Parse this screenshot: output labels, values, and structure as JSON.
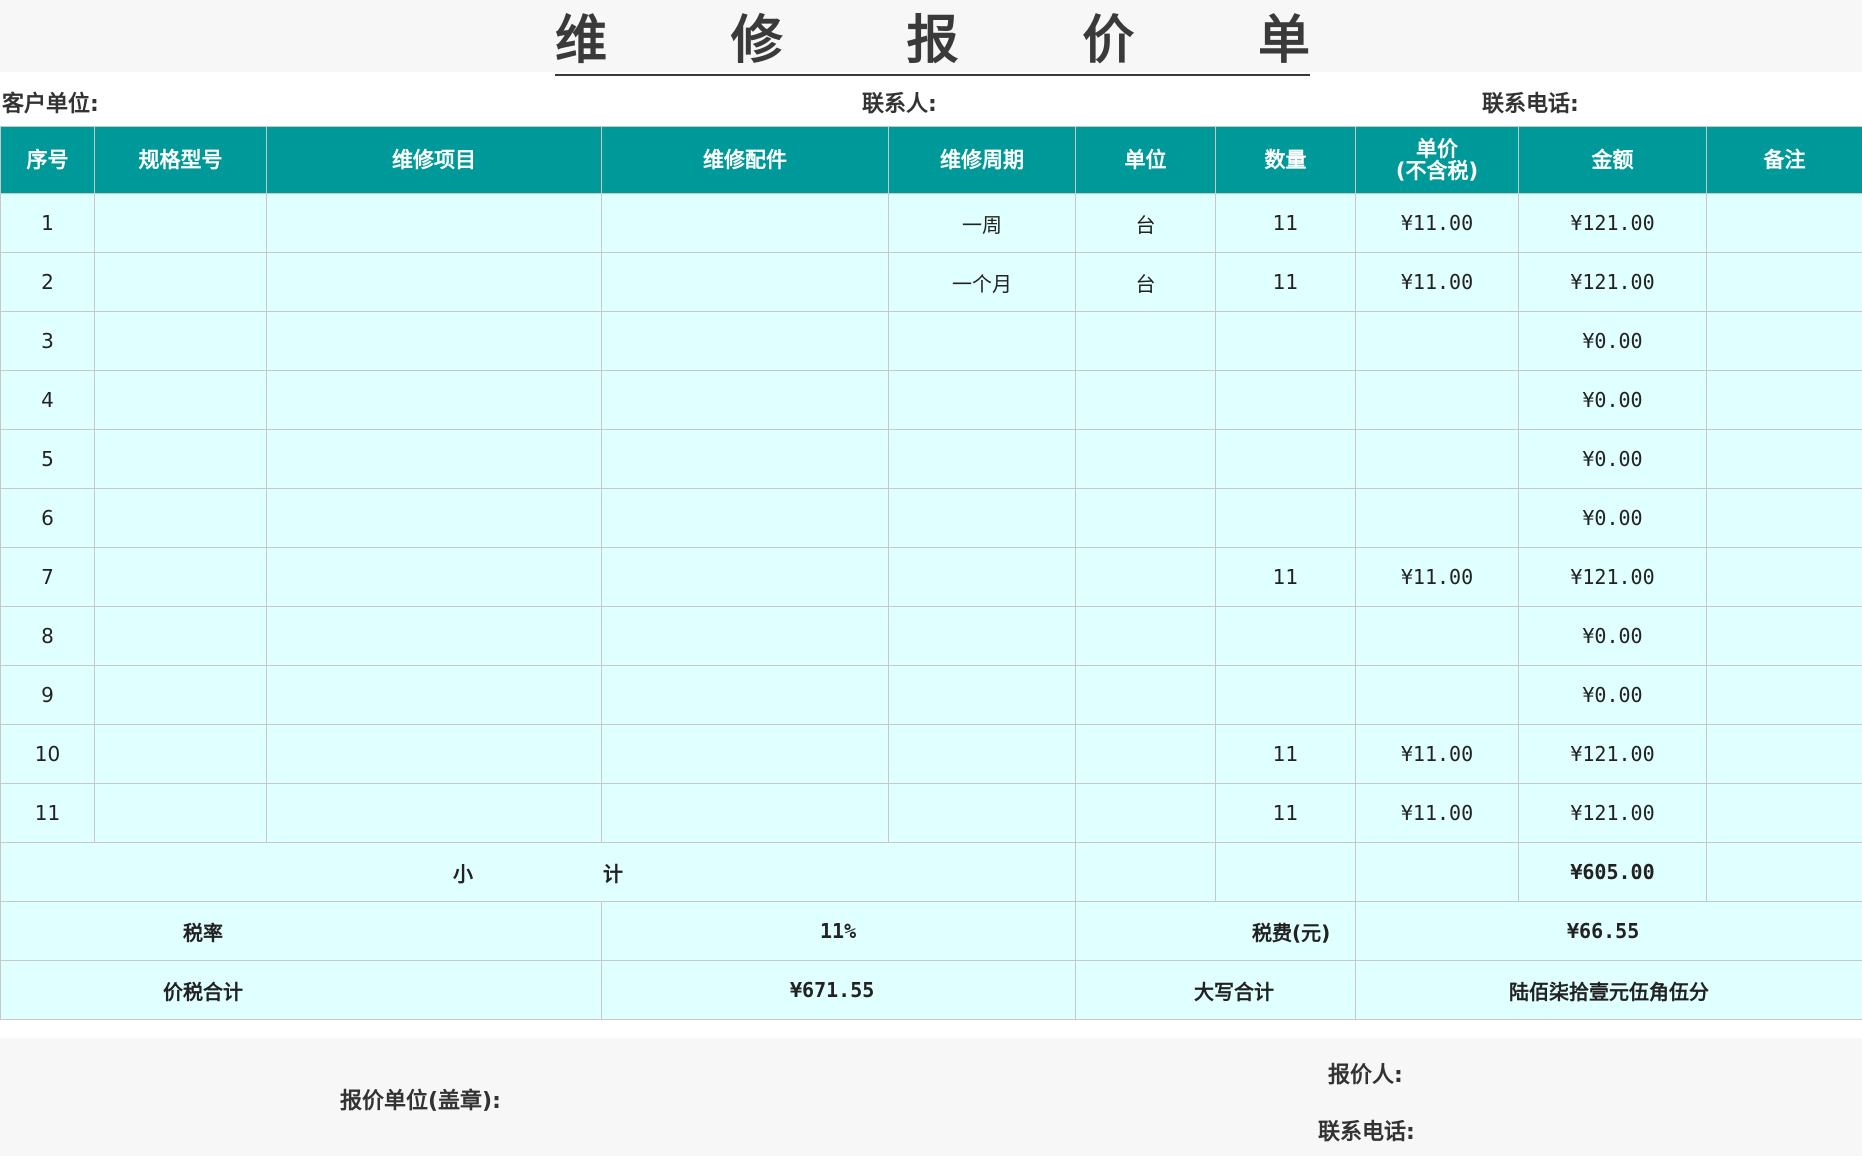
{
  "title": [
    "维",
    "修",
    "报",
    "价",
    "单"
  ],
  "info": {
    "client_label": "客户单位:",
    "contact_label": "联系人:",
    "phone_label": "联系电话:"
  },
  "headers": [
    "序号",
    "规格型号",
    "维修项目",
    "维修配件",
    "维修周期",
    "单位",
    "数量",
    "单价\n(不含税)",
    "金额",
    "备注"
  ],
  "rows": [
    {
      "no": "1",
      "spec": "",
      "item": "",
      "part": "",
      "cycle": "一周",
      "unit": "台",
      "qty": "11",
      "price": "¥11.00",
      "amount": "¥121.00",
      "note": ""
    },
    {
      "no": "2",
      "spec": "",
      "item": "",
      "part": "",
      "cycle": "一个月",
      "unit": "台",
      "qty": "11",
      "price": "¥11.00",
      "amount": "¥121.00",
      "note": ""
    },
    {
      "no": "3",
      "spec": "",
      "item": "",
      "part": "",
      "cycle": "",
      "unit": "",
      "qty": "",
      "price": "",
      "amount": "¥0.00",
      "note": ""
    },
    {
      "no": "4",
      "spec": "",
      "item": "",
      "part": "",
      "cycle": "",
      "unit": "",
      "qty": "",
      "price": "",
      "amount": "¥0.00",
      "note": ""
    },
    {
      "no": "5",
      "spec": "",
      "item": "",
      "part": "",
      "cycle": "",
      "unit": "",
      "qty": "",
      "price": "",
      "amount": "¥0.00",
      "note": ""
    },
    {
      "no": "6",
      "spec": "",
      "item": "",
      "part": "",
      "cycle": "",
      "unit": "",
      "qty": "",
      "price": "",
      "amount": "¥0.00",
      "note": ""
    },
    {
      "no": "7",
      "spec": "",
      "item": "",
      "part": "",
      "cycle": "",
      "unit": "",
      "qty": "11",
      "price": "¥11.00",
      "amount": "¥121.00",
      "note": ""
    },
    {
      "no": "8",
      "spec": "",
      "item": "",
      "part": "",
      "cycle": "",
      "unit": "",
      "qty": "",
      "price": "",
      "amount": "¥0.00",
      "note": ""
    },
    {
      "no": "9",
      "spec": "",
      "item": "",
      "part": "",
      "cycle": "",
      "unit": "",
      "qty": "",
      "price": "",
      "amount": "¥0.00",
      "note": ""
    },
    {
      "no": "10",
      "spec": "",
      "item": "",
      "part": "",
      "cycle": "",
      "unit": "",
      "qty": "11",
      "price": "¥11.00",
      "amount": "¥121.00",
      "note": ""
    },
    {
      "no": "11",
      "spec": "",
      "item": "",
      "part": "",
      "cycle": "",
      "unit": "",
      "qty": "11",
      "price": "¥11.00",
      "amount": "¥121.00",
      "note": ""
    }
  ],
  "subtotal": {
    "label_a": "小",
    "label_b": "计",
    "amount": "¥605.00"
  },
  "tax": {
    "rate_label": "税率",
    "rate": "11%",
    "fee_label": "税费(元)",
    "fee": "¥66.55"
  },
  "total": {
    "label": "价税合计",
    "value": "¥671.55",
    "upper_label": "大写合计",
    "upper_value": "陆佰柒拾壹元伍角伍分"
  },
  "footer": {
    "quote_unit_label": "报价单位(盖章):",
    "quoter_label": "报价人:",
    "phone_label": "联系电话:"
  }
}
